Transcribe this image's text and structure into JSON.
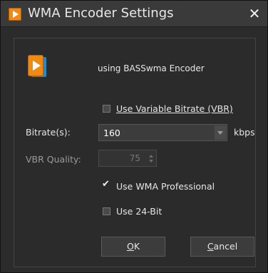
{
  "window": {
    "title": "WMA Encoder Settings",
    "close_glyph": "✕"
  },
  "encoder_info": "using BASSwma Encoder",
  "vbr_checkbox": {
    "label": "Use Variable Bitrate (VBR)",
    "checked": false
  },
  "bitrate": {
    "label": "Bitrate(s):",
    "value": "160",
    "units": "kbps"
  },
  "vbr_quality": {
    "label": "VBR Quality:",
    "value": "75",
    "enabled": false
  },
  "wma_pro_checkbox": {
    "label": "Use WMA Professional",
    "checked": true
  },
  "bit24_checkbox": {
    "label": "Use 24-Bit",
    "checked": false
  },
  "buttons": {
    "ok": {
      "mnemonic": "O",
      "rest": "K"
    },
    "cancel": {
      "mnemonic": "C",
      "rest": "ancel"
    }
  },
  "icons": {
    "app": "media-player-icon",
    "close": "close-icon"
  },
  "colors": {
    "background": "#2b2b2b",
    "titlebar": "#3a3a3a",
    "accent_orange": "#f08a12",
    "accent_blue": "#1f8bd0",
    "text": "#e6e6e6",
    "disabled_text": "#777777"
  }
}
